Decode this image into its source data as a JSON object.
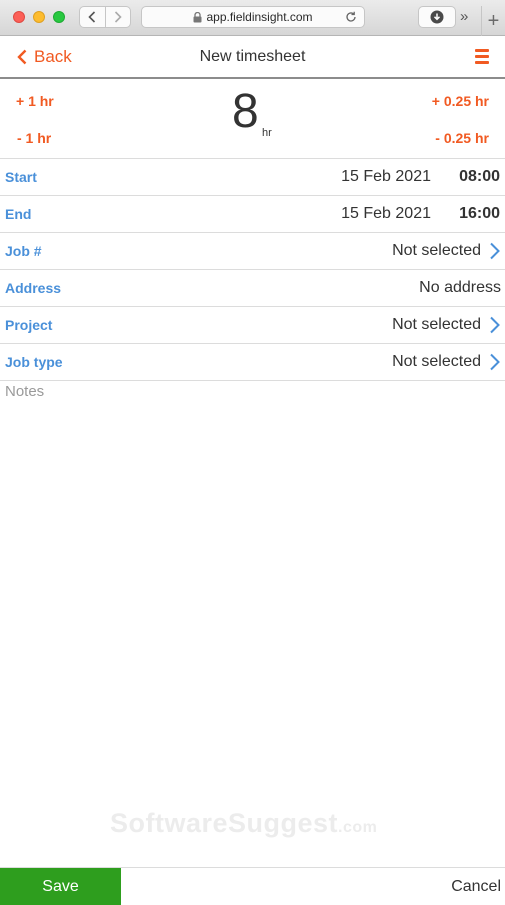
{
  "browser": {
    "url": "app.fieldinsight.com"
  },
  "header": {
    "back_label": "Back",
    "title": "New timesheet"
  },
  "hours": {
    "plus_1": "+ 1 hr",
    "minus_1": "- 1 hr",
    "plus_quarter": "+ 0.25 hr",
    "minus_quarter": "- 0.25 hr",
    "value": "8",
    "unit": "hr"
  },
  "fields": {
    "start": {
      "label": "Start",
      "date": "15 Feb 2021",
      "time": "08:00"
    },
    "end": {
      "label": "End",
      "date": "15 Feb 2021",
      "time": "16:00"
    },
    "job": {
      "label": "Job #",
      "value": "Not selected"
    },
    "address": {
      "label": "Address",
      "value": "No address"
    },
    "project": {
      "label": "Project",
      "value": "Not selected"
    },
    "job_type": {
      "label": "Job type",
      "value": "Not selected"
    }
  },
  "notes": {
    "placeholder": "Notes"
  },
  "watermark": {
    "brand": "SoftwareSuggest",
    "tld": ".com"
  },
  "footer": {
    "save_label": "Save",
    "cancel_label": "Cancel"
  },
  "colors": {
    "accent": "#f15a22",
    "label_blue": "#4a90d9",
    "save_green": "#2e9e1e"
  }
}
